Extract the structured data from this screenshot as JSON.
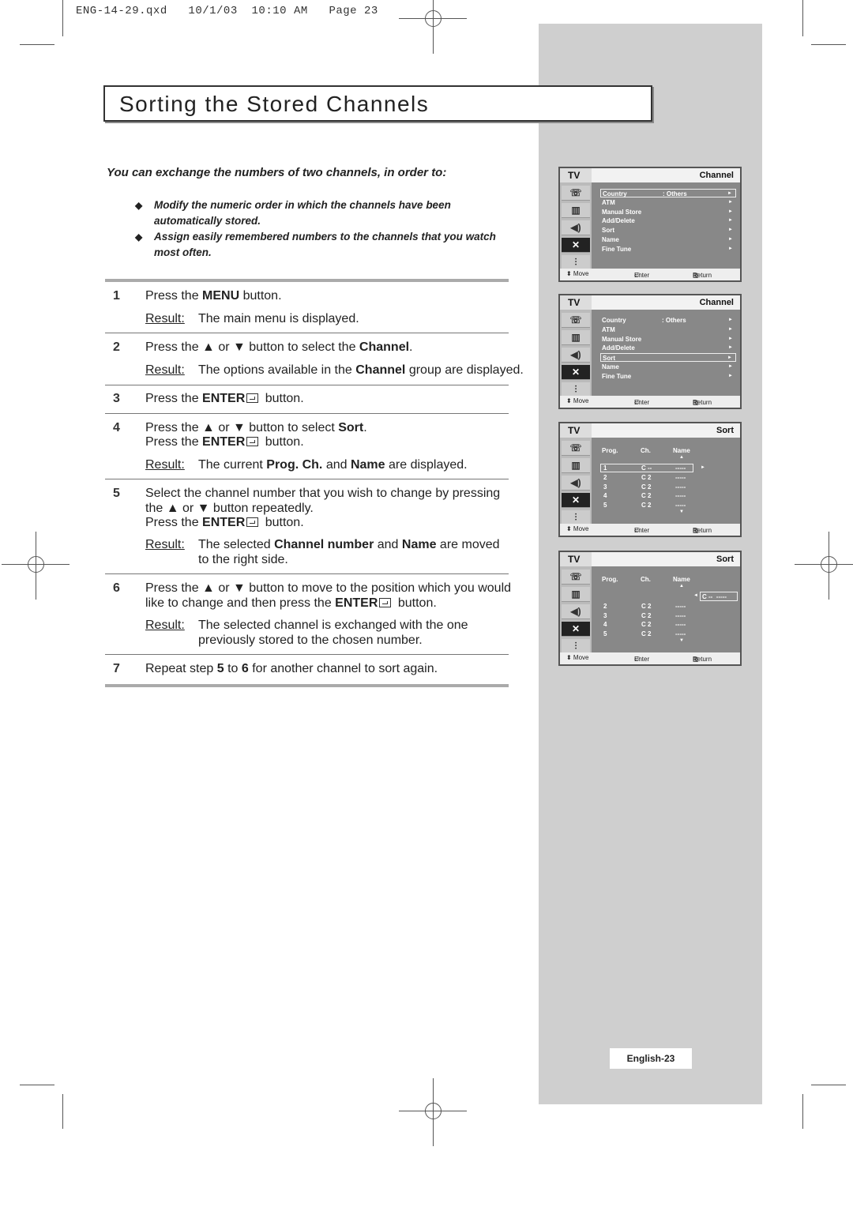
{
  "print_header": "ENG-14-29.qxd   10/1/03  10:10 AM   Page 23",
  "title": "Sorting the Stored Channels",
  "intro": "You can exchange the numbers of two channels, in order to:",
  "bullets": [
    "Modify the numeric order in which the channels have been automatically stored.",
    "Assign easily remembered numbers to the channels that you watch most often."
  ],
  "result_label": "Result:",
  "steps": {
    "s1": {
      "n": "1",
      "a": "Press the ",
      "b": "MENU",
      "c": " button.",
      "r": "The main menu is displayed."
    },
    "s2": {
      "n": "2",
      "a": "Press the ▲ or ▼ button to select the ",
      "b": "Channel",
      "c": ".",
      "r1": "The options available in the ",
      "r2": "Channel",
      "r3": " group are displayed."
    },
    "s3": {
      "n": "3",
      "a": "Press the ",
      "b": "ENTER",
      "c": " button."
    },
    "s4": {
      "n": "4",
      "a": "Press the ▲ or ▼ button to select ",
      "b": "Sort",
      "c": ".",
      "d": "Press the ",
      "e": "ENTER",
      "f": " button.",
      "r1": "The current ",
      "r2": "Prog. Ch.",
      "r3": " and ",
      "r4": "Name",
      "r5": " are displayed."
    },
    "s5": {
      "n": "5",
      "l1": "Select the channel number that you wish to change by pressing",
      "l2": "the ▲ or ▼ button repeatedly.",
      "d": "Press the ",
      "e": "ENTER",
      "f": " button.",
      "r1": "The selected ",
      "r2": "Channel number",
      "r3": " and ",
      "r4": "Name",
      "r5": " are moved",
      "r6": "to the right side."
    },
    "s6": {
      "n": "6",
      "l1": "Press the ▲ or ▼ button to move to the position which you would",
      "l2a": "like to change and then press the ",
      "l2b": "ENTER",
      "l2c": " button.",
      "r1": "The selected channel is exchanged with the one",
      "r2": "previously stored to the chosen number."
    },
    "s7": {
      "n": "7",
      "a": "Repeat step ",
      "b": "5",
      "c": " to ",
      "d": "6",
      "e": " for another channel to sort again."
    }
  },
  "menus": [
    {
      "tv": "TV",
      "title": "Channel",
      "kind": "list",
      "selected": 0,
      "items": [
        [
          "Country",
          ": Others"
        ],
        [
          "ATM",
          ""
        ],
        [
          "Manual Store",
          ""
        ],
        [
          "Add/Delete",
          ""
        ],
        [
          "Sort",
          ""
        ],
        [
          "Name",
          ""
        ],
        [
          "Fine Tune",
          ""
        ]
      ],
      "foot": [
        "⬍ Move",
        "Enter",
        "Return"
      ]
    },
    {
      "tv": "TV",
      "title": "Channel",
      "kind": "list",
      "selected": 4,
      "items": [
        [
          "Country",
          ": Others"
        ],
        [
          "ATM",
          ""
        ],
        [
          "Manual Store",
          ""
        ],
        [
          "Add/Delete",
          ""
        ],
        [
          "Sort",
          ""
        ],
        [
          "Name",
          ""
        ],
        [
          "Fine Tune",
          ""
        ]
      ],
      "foot": [
        "⬍ Move",
        "Enter",
        "Return"
      ]
    },
    {
      "tv": "TV",
      "title": "Sort",
      "kind": "sort",
      "headers": [
        "Prog.",
        "Ch.",
        "Name"
      ],
      "rows": [
        [
          "1",
          "C --",
          "-----"
        ],
        [
          "2",
          "C 2",
          "-----"
        ],
        [
          "3",
          "C 2",
          "-----"
        ],
        [
          "4",
          "C 2",
          "-----"
        ],
        [
          "5",
          "C 2",
          "-----"
        ]
      ],
      "selected": 0,
      "moved": "",
      "foot": [
        "⬍ Move",
        "Enter",
        "Return"
      ]
    },
    {
      "tv": "TV",
      "title": "Sort",
      "kind": "sort",
      "headers": [
        "Prog.",
        "Ch.",
        "Name"
      ],
      "rows": [
        [
          "",
          "",
          " "
        ],
        [
          "2",
          "C 2",
          "-----"
        ],
        [
          "3",
          "C 2",
          "-----"
        ],
        [
          "4",
          "C 2",
          "-----"
        ],
        [
          "5",
          "C 2",
          "-----"
        ]
      ],
      "selected": -1,
      "moved": "C --  -----",
      "foot": [
        "⬍ Move",
        "Enter",
        "Return"
      ]
    }
  ],
  "page_label": "English-23"
}
